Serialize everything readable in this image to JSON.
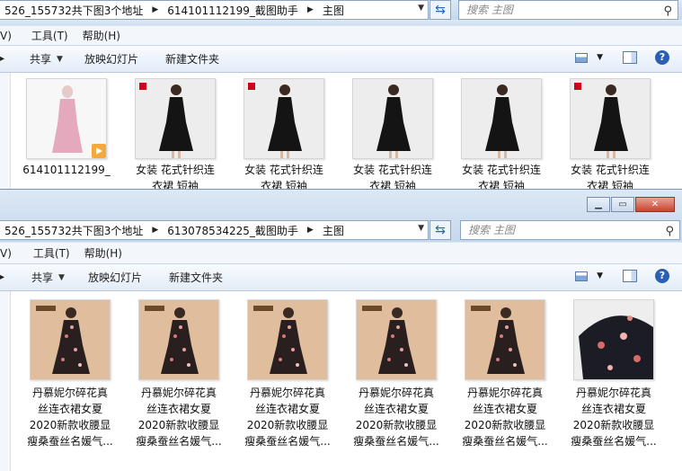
{
  "window1": {
    "breadcrumbs": [
      "526_155732共下图3个地址",
      "614101112199_截图助手",
      "主图"
    ],
    "search_placeholder": "搜索 主图",
    "menu": [
      "V)",
      "工具(T)",
      "帮助(H)"
    ],
    "toolbar": {
      "share": "共享",
      "slideshow": "放映幻灯片",
      "new_folder": "新建文件夹"
    },
    "items": [
      {
        "lines": [
          "614101112199_",
          "_"
        ],
        "kind": "video"
      },
      {
        "lines": [
          "女装 花式针织连",
          "衣裙 短袖"
        ],
        "kind": "black-dress"
      },
      {
        "lines": [
          "女装 花式针织连",
          "衣裙 短袖"
        ],
        "kind": "black-dress"
      },
      {
        "lines": [
          "女装 花式针织连",
          "衣裙 短袖"
        ],
        "kind": "black-dress-side"
      },
      {
        "lines": [
          "女装 花式针织连",
          "衣裙 短袖"
        ],
        "kind": "black-dress-back"
      },
      {
        "lines": [
          "女装 花式针织连",
          "衣裙 短袖"
        ],
        "kind": "black-dress"
      }
    ]
  },
  "window2": {
    "breadcrumbs": [
      "526_155732共下图3个地址",
      "613078534225_截图助手",
      "主图"
    ],
    "search_placeholder": "搜索 主图",
    "menu": [
      "V)",
      "工具(T)",
      "帮助(H)"
    ],
    "toolbar": {
      "share": "共享",
      "slideshow": "放映幻灯片",
      "new_folder": "新建文件夹"
    },
    "items": [
      {
        "lines": [
          "丹慕妮尔碎花真",
          "丝连衣裙女夏",
          "2020新款收腰显",
          "瘦桑蚕丝名媛气..."
        ],
        "kind": "floral"
      },
      {
        "lines": [
          "丹慕妮尔碎花真",
          "丝连衣裙女夏",
          "2020新款收腰显",
          "瘦桑蚕丝名媛气..."
        ],
        "kind": "floral"
      },
      {
        "lines": [
          "丹慕妮尔碎花真",
          "丝连衣裙女夏",
          "2020新款收腰显",
          "瘦桑蚕丝名媛气..."
        ],
        "kind": "floral"
      },
      {
        "lines": [
          "丹慕妮尔碎花真",
          "丝连衣裙女夏",
          "2020新款收腰显",
          "瘦桑蚕丝名媛气..."
        ],
        "kind": "floral"
      },
      {
        "lines": [
          "丹慕妮尔碎花真",
          "丝连衣裙女夏",
          "2020新款收腰显",
          "瘦桑蚕丝名媛气..."
        ],
        "kind": "floral"
      },
      {
        "lines": [
          "丹慕妮尔碎花真",
          "丝连衣裙女夏",
          "2020新款收腰显",
          "瘦桑蚕丝名媛气..."
        ],
        "kind": "fabric"
      }
    ]
  }
}
